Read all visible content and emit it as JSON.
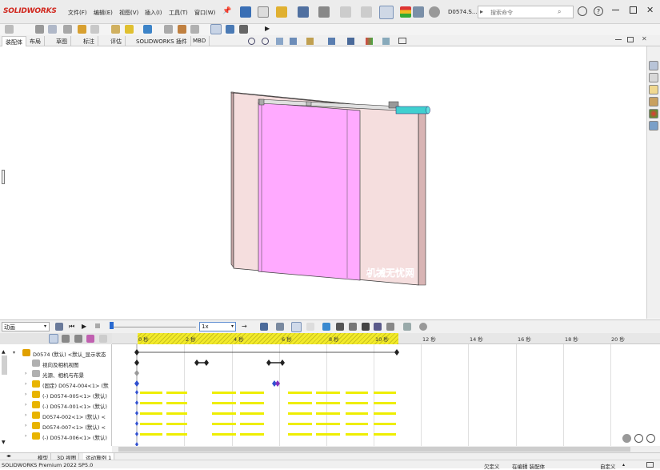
{
  "app": {
    "logo": "SOLIDWORKS",
    "doc_name": "D0574.S...",
    "search_placeholder": "搜索命令"
  },
  "menu": [
    "文件(F)",
    "编辑(E)",
    "视图(V)",
    "插入(I)",
    "工具(T)",
    "窗口(W)"
  ],
  "tabs": [
    "装配体",
    "布局",
    "草图",
    "标注",
    "评估",
    "SOLIDWORKS 插件",
    "MBD"
  ],
  "viewport": {
    "label_text": "机械无忧网"
  },
  "motion": {
    "study_type": "动画",
    "speed": "1x"
  },
  "timeline": {
    "ticks": [
      "0 秒",
      "2 秒",
      "4 秒",
      "6 秒",
      "8 秒",
      "10 秒",
      "12 秒",
      "14 秒",
      "16 秒",
      "18 秒",
      "20 秒"
    ]
  },
  "tree": [
    {
      "label": "D0574 (默认) <默认_显示状态",
      "expanded": true,
      "icon_color": "#e0a000",
      "level": 0
    },
    {
      "label": "视向及相机视图",
      "icon_color": "#b0b0b0",
      "level": 1
    },
    {
      "label": "光源、相机与布景",
      "icon_color": "#b0b0b0",
      "level": 1
    },
    {
      "label": "(固定) D0574-004<1> (默",
      "icon_color": "#e8b400",
      "level": 1
    },
    {
      "label": "(-) D0574-005<1> (默认)",
      "icon_color": "#e8b400",
      "level": 1
    },
    {
      "label": "(-) D0574-001<1> (默认)",
      "icon_color": "#e8b400",
      "level": 1
    },
    {
      "label": "D0574-002<1> (默认) <",
      "icon_color": "#e8b400",
      "level": 1
    },
    {
      "label": "D0574-007<1> (默认) <",
      "icon_color": "#e8b400",
      "level": 1
    },
    {
      "label": "(-) D0574-006<1> (默认)",
      "icon_color": "#e8b400",
      "level": 1
    }
  ],
  "model_tabs": [
    "模型",
    "3D 视图",
    "运动算例 1"
  ],
  "status": {
    "version": "SOLIDWORKS Premium 2022 SP5.0",
    "undefined": "欠定义",
    "editing": "在编辑 装配体",
    "custom": "自定义"
  }
}
